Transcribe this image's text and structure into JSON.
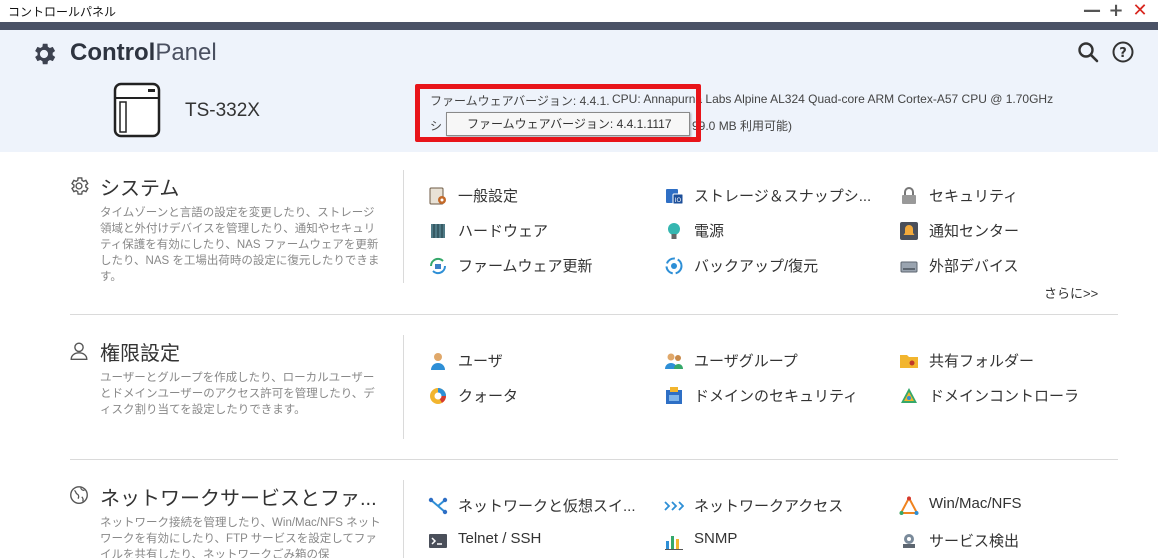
{
  "window": {
    "title": "コントロールパネル",
    "min": "—",
    "max": "+",
    "close": "✕"
  },
  "header": {
    "app_title_bold": "Control",
    "app_title_light": "Panel",
    "model": "TS-332X",
    "firmware_label": "ファームウェアバージョン: 4.4.1.",
    "cpu_text": "CPU: Annapurna Labs Alpine AL324 Quad-core ARM Cortex-A57 CPU @ 1.70GHz",
    "row2_prefix": "シ",
    "memory_text": "99.0 MB 利用可能)",
    "tooltip": "ファームウェアバージョン: 4.4.1.1117"
  },
  "sections": [
    {
      "title": "システム",
      "desc": "タイムゾーンと言語の設定を変更したり、ストレージ領域と外付けデバイスを管理したり、通知やセキュリティ保護を有効にしたり、NAS ファームウェアを更新したり、NAS を工場出荷時の設定に復元したりできます。",
      "items": [
        "一般設定",
        "ストレージ＆スナップシ...",
        "セキュリティ",
        "ハードウェア",
        "電源",
        "通知センター",
        "ファームウェア更新",
        "バックアップ/復元",
        "外部デバイス"
      ],
      "more": "さらに>>"
    },
    {
      "title": "権限設定",
      "desc": "ユーザーとグループを作成したり、ローカルユーザーとドメインユーザーのアクセス許可を管理したり、ディスク割り当てを設定したりできます。",
      "items": [
        "ユーザ",
        "ユーザグループ",
        "共有フォルダー",
        "クォータ",
        "ドメインのセキュリティ",
        "ドメインコントローラ"
      ]
    },
    {
      "title": "ネットワークサービスとファ...",
      "desc": "ネットワーク接続を管理したり、Win/Mac/NFS ネットワークを有効にしたり、FTP サービスを設定してファイルを共有したり、ネットワークごみ箱の保",
      "items": [
        "ネットワークと仮想スイ...",
        "ネットワークアクセス",
        "Win/Mac/NFS",
        "Telnet / SSH",
        "SNMP",
        "サービス検出"
      ]
    }
  ]
}
